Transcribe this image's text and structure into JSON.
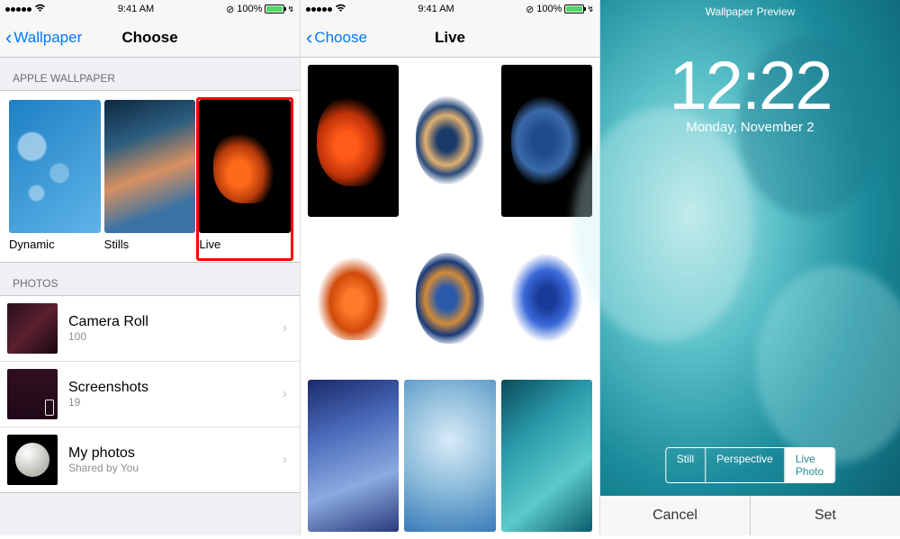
{
  "statusbar": {
    "time": "9:41 AM",
    "orientation_lock": "⊘",
    "battery": "100%",
    "bolt": "↯"
  },
  "screen1": {
    "back_label": "Wallpaper",
    "title": "Choose",
    "sections": {
      "apple": "APPLE WALLPAPER",
      "photos": "PHOTOS"
    },
    "wallpapers": {
      "dynamic": "Dynamic",
      "stills": "Stills",
      "live": "Live"
    },
    "albums": [
      {
        "name": "Camera Roll",
        "sub": "100"
      },
      {
        "name": "Screenshots",
        "sub": "19"
      },
      {
        "name": "My photos",
        "sub": "Shared by You"
      }
    ]
  },
  "screen2": {
    "back_label": "Choose",
    "title": "Live"
  },
  "screen3": {
    "header": "Wallpaper Preview",
    "time": "12:22",
    "date": "Monday, November 2",
    "segments": {
      "still": "Still",
      "perspective": "Perspective",
      "live": "Live Photo"
    },
    "buttons": {
      "cancel": "Cancel",
      "set": "Set"
    }
  }
}
